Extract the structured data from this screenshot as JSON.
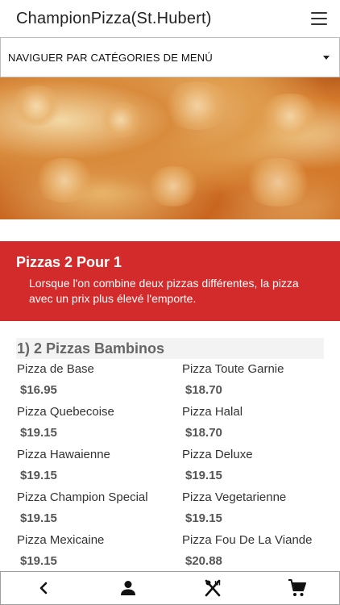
{
  "header": {
    "title": "ChampionPizza(St.Hubert)",
    "menu_icon": "hamburger-menu-icon"
  },
  "category_selector": {
    "label": "NAVIGUER PAR CATÉGORIES DE MENÚ",
    "icon": "caret-down-icon"
  },
  "hero": {
    "image": "fried-chicken-photo"
  },
  "promo": {
    "title": "Pizzas 2 Pour 1",
    "description": "Lorsque l'on combine deux pizzas différentes, la pizza avec un prix plus élevé l'emporte."
  },
  "section": {
    "title": "1)  2 Pizzas Bambinos",
    "items": [
      {
        "name": "Pizza de Base",
        "price": "$16.95"
      },
      {
        "name": "Pizza Toute Garnie",
        "price": "$18.70"
      },
      {
        "name": "Pizza Quebecoise",
        "price": "$19.15"
      },
      {
        "name": "Pizza Halal",
        "price": "$18.70"
      },
      {
        "name": "Pizza Hawaienne",
        "price": "$19.15"
      },
      {
        "name": "Pizza Deluxe",
        "price": "$19.15"
      },
      {
        "name": "Pizza Champion Special",
        "price": "$19.15"
      },
      {
        "name": "Pizza Vegetarienne",
        "price": "$19.15"
      },
      {
        "name": "Pizza Mexicaine",
        "price": "$19.15"
      },
      {
        "name": "Pizza Fou De La Viande",
        "price": "$20.88"
      }
    ]
  },
  "bottom_nav": {
    "items": [
      {
        "icon": "back-chevron-icon"
      },
      {
        "icon": "user-account-icon"
      },
      {
        "icon": "restaurant-menu-icon"
      },
      {
        "icon": "shopping-cart-icon"
      }
    ]
  },
  "colors": {
    "accent": "#d32b2b",
    "section_bg": "#f3f3f3",
    "text": "#333333"
  }
}
